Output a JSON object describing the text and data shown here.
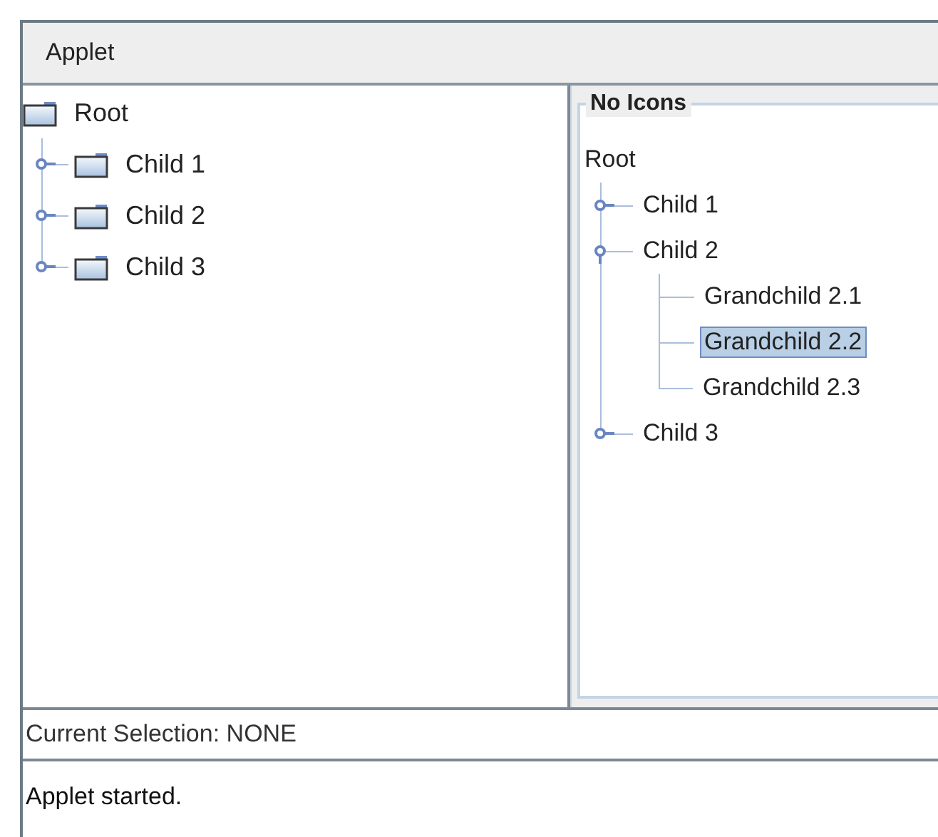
{
  "window": {
    "title": "Applet"
  },
  "left_tree": {
    "icons": true,
    "root": {
      "label": "Root",
      "selected": false,
      "expanded": true,
      "children": [
        {
          "label": "Child 1",
          "selected": false,
          "expanded": false
        },
        {
          "label": "Child 2",
          "selected": false,
          "expanded": false
        },
        {
          "label": "Child 3",
          "selected": false,
          "expanded": false
        }
      ]
    }
  },
  "right_tree": {
    "title": "No Icons",
    "icons": false,
    "root": {
      "label": "Root",
      "selected": false,
      "expanded": true,
      "children": [
        {
          "label": "Child 1",
          "selected": false,
          "expanded": false
        },
        {
          "label": "Child 2",
          "selected": false,
          "expanded": true,
          "children": [
            {
              "label": "Grandchild 2.1",
              "selected": false
            },
            {
              "label": "Grandchild 2.2",
              "selected": true
            },
            {
              "label": "Grandchild 2.3",
              "selected": false
            }
          ]
        },
        {
          "label": "Child 3",
          "selected": false,
          "expanded": false
        }
      ]
    }
  },
  "selection_field": {
    "value": "Current Selection: NONE"
  },
  "status_bar": {
    "text": "Applet started."
  }
}
